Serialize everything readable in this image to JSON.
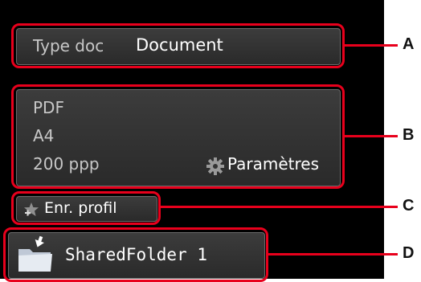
{
  "doc_type": {
    "label": "Type doc",
    "value": "Document"
  },
  "scan_settings": {
    "format": "PDF",
    "paper_size": "A4",
    "resolution": "200 ppp",
    "settings_label": "Paramètres"
  },
  "save_profile": {
    "label": "Enr. profil"
  },
  "destination": {
    "folder_name": "SharedFolder 1"
  },
  "callouts": [
    "A",
    "B",
    "C",
    "D"
  ],
  "colors": {
    "highlight": "#e8001c",
    "screen": "#000000",
    "panel": "#333333"
  }
}
